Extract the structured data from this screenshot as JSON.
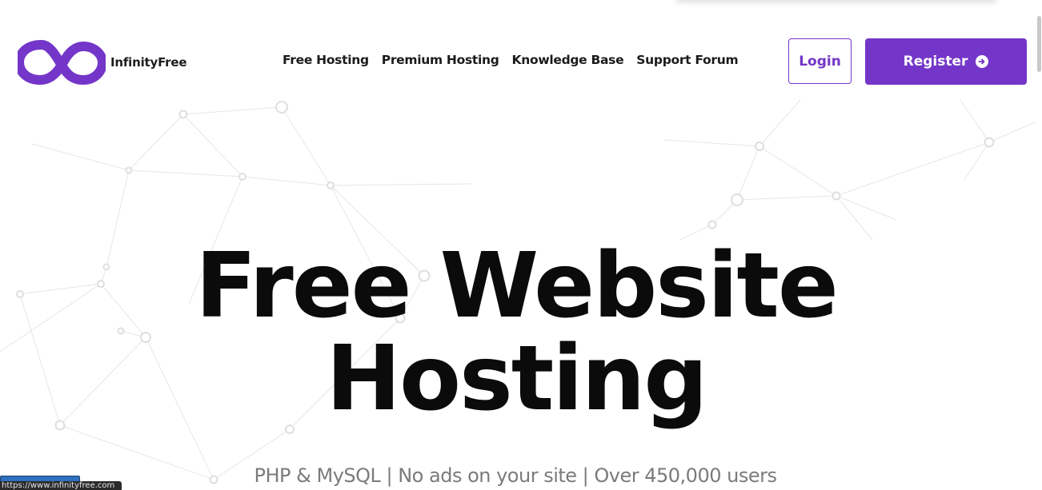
{
  "brand": {
    "name": "InfinityFree",
    "logo_icon": "infinity-logo-icon",
    "accent": "#7436c8"
  },
  "nav": {
    "items": [
      {
        "label": "Free Hosting"
      },
      {
        "label": "Premium Hosting"
      },
      {
        "label": "Knowledge Base"
      },
      {
        "label": "Support Forum"
      }
    ]
  },
  "actions": {
    "login_label": "Login",
    "register_label": "Register",
    "register_icon": "arrow-right-circle-icon"
  },
  "hero": {
    "title_line1": "Free Website",
    "title_line2": "Hosting",
    "subtitle": "PHP & MySQL | No ads on your site | Over 450,000 users"
  },
  "status_bar": {
    "url": "https://www.infinityfree.com"
  },
  "colors": {
    "accent": "#7436c8",
    "text": "#0b0b0b",
    "muted": "#7b7b7b"
  }
}
